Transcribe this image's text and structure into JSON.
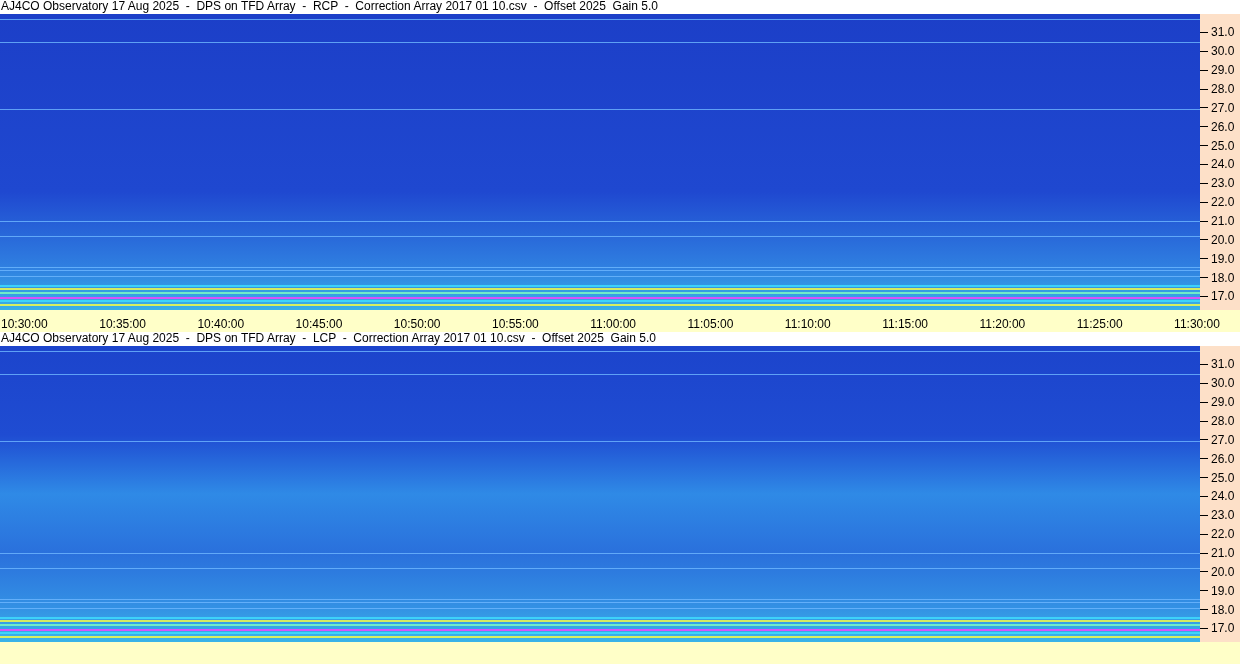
{
  "panels": [
    {
      "title": "AJ4CO Observatory 17 Aug 2025  -  DPS on TFD Array  -  RCP  -  Correction Array 2017 01 10.csv  -  Offset 2025  Gain 5.0",
      "frequency_ticks": [
        "31.0",
        "30.0",
        "29.0",
        "28.0",
        "27.0",
        "26.0",
        "25.0",
        "24.0",
        "23.0",
        "22.0",
        "21.0",
        "20.0",
        "19.0",
        "18.0",
        "17.0"
      ],
      "time_ticks": [
        "10:30:00",
        "10:35:00",
        "10:40:00",
        "10:45:00",
        "10:50:00",
        "10:55:00",
        "11:00:00",
        "11:05:00",
        "11:10:00",
        "11:15:00",
        "11:20:00",
        "11:25:00",
        "11:30:00"
      ]
    },
    {
      "title": "AJ4CO Observatory 17 Aug 2025  -  DPS on TFD Array  -  LCP  -  Correction Array 2017 01 10.csv  -  Offset 2025  Gain 5.0",
      "frequency_ticks": [
        "31.0",
        "30.0",
        "29.0",
        "28.0",
        "27.0",
        "26.0",
        "25.0",
        "24.0",
        "23.0",
        "22.0",
        "21.0",
        "20.0",
        "19.0",
        "18.0",
        "17.0"
      ]
    }
  ]
}
